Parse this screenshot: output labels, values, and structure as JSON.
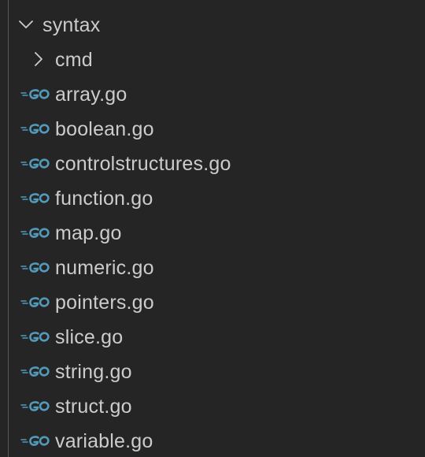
{
  "tree": {
    "root_folder": {
      "label": "syntax",
      "expanded": true,
      "icon": "chevron-down-icon"
    },
    "sub_folder": {
      "label": "cmd",
      "expanded": false,
      "icon": "chevron-right-icon"
    },
    "files": [
      {
        "label": "array.go"
      },
      {
        "label": "boolean.go"
      },
      {
        "label": "controlstructures.go"
      },
      {
        "label": "function.go"
      },
      {
        "label": "map.go"
      },
      {
        "label": "numeric.go"
      },
      {
        "label": "pointers.go"
      },
      {
        "label": "slice.go"
      },
      {
        "label": "string.go"
      },
      {
        "label": "struct.go"
      },
      {
        "label": "variable.go"
      }
    ],
    "file_icon": {
      "name": "go-file-icon",
      "color": "#519aba"
    }
  },
  "colors": {
    "background": "#252526",
    "text": "#cccccc",
    "indent_guide": "#585858"
  }
}
